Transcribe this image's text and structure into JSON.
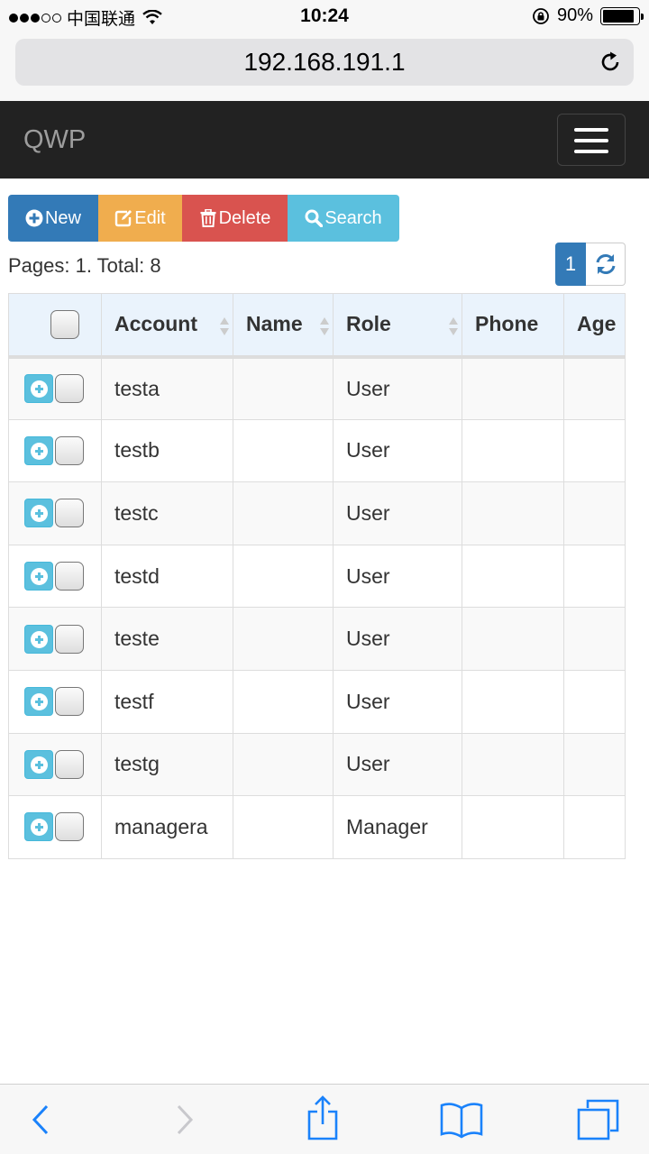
{
  "status_bar": {
    "carrier": "中国联通",
    "time": "10:24",
    "battery_percent": "90%",
    "battery_level": 0.9,
    "signal_bars_filled": 3,
    "signal_bars_total": 5
  },
  "browser": {
    "url": "192.168.191.1"
  },
  "navbar": {
    "brand": "QWP"
  },
  "toolbar": {
    "new_label": "New",
    "edit_label": "Edit",
    "delete_label": "Delete",
    "search_label": "Search"
  },
  "pagination": {
    "info": "Pages: 1. Total: 8",
    "current_page": "1"
  },
  "table": {
    "columns": [
      "Account",
      "Name",
      "Role",
      "Phone",
      "Age"
    ],
    "rows": [
      {
        "account": "testa",
        "name": "",
        "role": "User",
        "phone": "",
        "age": ""
      },
      {
        "account": "testb",
        "name": "",
        "role": "User",
        "phone": "",
        "age": ""
      },
      {
        "account": "testc",
        "name": "",
        "role": "User",
        "phone": "",
        "age": ""
      },
      {
        "account": "testd",
        "name": "",
        "role": "User",
        "phone": "",
        "age": ""
      },
      {
        "account": "teste",
        "name": "",
        "role": "User",
        "phone": "",
        "age": ""
      },
      {
        "account": "testf",
        "name": "",
        "role": "User",
        "phone": "",
        "age": ""
      },
      {
        "account": "testg",
        "name": "",
        "role": "User",
        "phone": "",
        "age": ""
      },
      {
        "account": "managera",
        "name": "",
        "role": "Manager",
        "phone": "",
        "age": ""
      }
    ]
  },
  "colors": {
    "primary": "#337ab7",
    "warning": "#f0ad4e",
    "danger": "#d9534f",
    "info": "#5bc0de",
    "navbar_bg": "#222222",
    "ios_blue": "#1a82fb"
  },
  "icons": {
    "new": "plus-circle-icon",
    "edit": "edit-icon",
    "delete": "trash-icon",
    "search": "search-icon",
    "refresh": "refresh-icon",
    "reload": "reload-icon",
    "menu": "hamburger-icon",
    "back": "chevron-left-icon",
    "forward": "chevron-right-icon",
    "share": "share-icon",
    "bookmarks": "book-icon",
    "tabs": "tabs-icon"
  }
}
